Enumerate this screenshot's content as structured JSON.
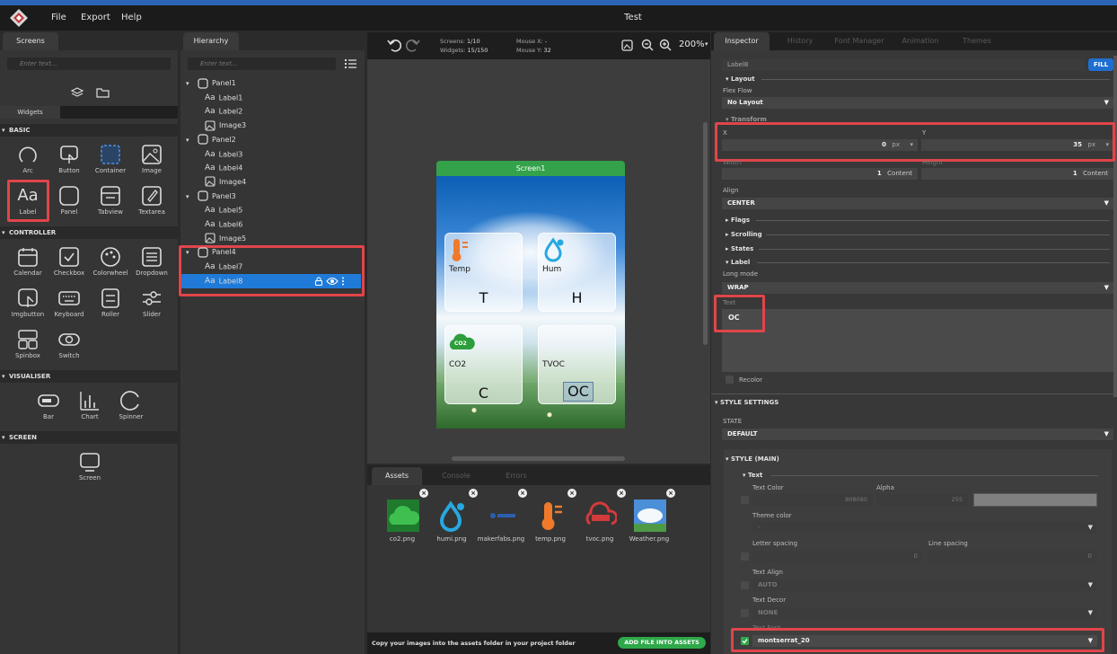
{
  "window": {
    "title": "Test"
  },
  "menu": {
    "file": "File",
    "export": "Export",
    "help": "Help"
  },
  "screens_panel": {
    "tab": "Screens",
    "search_placeholder": "Enter text...",
    "widgets_tab": "Widgets"
  },
  "widgets": {
    "basic": {
      "title": "BASIC",
      "items": [
        "Arc",
        "Button",
        "Container",
        "Image",
        "Label",
        "Panel",
        "Tabview",
        "Textarea"
      ]
    },
    "controller": {
      "title": "CONTROLLER",
      "items": [
        "Calendar",
        "Checkbox",
        "Colorwheel",
        "Dropdown",
        "Imgbutton",
        "Keyboard",
        "Roller",
        "Slider",
        "Spinbox",
        "Switch"
      ]
    },
    "visualiser": {
      "title": "VISUALISER",
      "items": [
        "Bar",
        "Chart",
        "Spinner"
      ]
    },
    "screen": {
      "title": "SCREEN",
      "items": [
        "Screen"
      ]
    }
  },
  "hierarchy": {
    "tab": "Hierarchy",
    "search_placeholder": "Enter text...",
    "rows": [
      {
        "label": "Panel1",
        "type": "panel"
      },
      {
        "label": "Label1",
        "type": "label"
      },
      {
        "label": "Label2",
        "type": "label"
      },
      {
        "label": "Image3",
        "type": "image"
      },
      {
        "label": "Panel2",
        "type": "panel"
      },
      {
        "label": "Label3",
        "type": "label"
      },
      {
        "label": "Label4",
        "type": "label"
      },
      {
        "label": "Image4",
        "type": "image"
      },
      {
        "label": "Panel3",
        "type": "panel"
      },
      {
        "label": "Label5",
        "type": "label"
      },
      {
        "label": "Label6",
        "type": "label"
      },
      {
        "label": "Image5",
        "type": "image"
      },
      {
        "label": "Panel4",
        "type": "panel"
      },
      {
        "label": "Label7",
        "type": "label"
      },
      {
        "label": "Label8",
        "type": "label",
        "selected": true
      }
    ]
  },
  "canvas": {
    "screens_label": "Screens:",
    "screens_value": "1/10",
    "widgets_label": "Widgets:",
    "widgets_value": "15/150",
    "mouse_x_label": "Mouse X:",
    "mouse_x_value": "-",
    "mouse_y_label": "Mouse Y:",
    "mouse_y_value": "32",
    "zoom": "200%",
    "screen_title": "Screen1",
    "cards": [
      {
        "label": "Temp",
        "value": "T"
      },
      {
        "label": "Hum",
        "value": "H"
      },
      {
        "label": "CO2",
        "value": "C",
        "badge": "CO2"
      },
      {
        "label": "TVOC",
        "value": "OC"
      }
    ]
  },
  "bottom": {
    "tabs": [
      "Assets",
      "Console",
      "Errors"
    ],
    "assets": [
      "co2.png",
      "humi.png",
      "makerfabs.png",
      "temp.png",
      "tvoc.png",
      "Weather.png"
    ],
    "hint": "Copy your images into the assets folder in your project folder",
    "add_button": "ADD FILE INTO ASSETS"
  },
  "inspector": {
    "tabs": [
      "Inspector",
      "History",
      "Font Manager",
      "Animation",
      "Themes"
    ],
    "name": "Label8",
    "fill_button": "FILL",
    "layout": {
      "title": "Layout",
      "flex_flow_label": "Flex Flow",
      "flex_flow_value": "No Layout"
    },
    "transform": {
      "title": "Transform",
      "x_label": "X",
      "x_value": "0",
      "x_unit": "px",
      "y_label": "Y",
      "y_value": "35",
      "y_unit": "px",
      "width_label": "Width",
      "width_value": "1",
      "width_unit": "Content",
      "height_label": "Height",
      "height_value": "1",
      "height_unit": "Content"
    },
    "align": {
      "label": "Align",
      "value": "CENTER"
    },
    "collapsed": [
      "Flags",
      "Scrolling",
      "States"
    ],
    "label": {
      "title": "Label",
      "long_mode_label": "Long mode",
      "long_mode_value": "WRAP",
      "text_label": "Text",
      "text_value": "OC",
      "recolor_label": "Recolor"
    },
    "style_settings": {
      "title": "STYLE SETTINGS",
      "state_label": "STATE",
      "state_value": "DEFAULT",
      "style_main": "STYLE (MAIN)",
      "text_section": "Text",
      "text_color_label": "Text Color",
      "text_color_value": "808080",
      "alpha_label": "Alpha",
      "alpha_value": "255",
      "theme_color_label": "Theme color",
      "theme_color_value": "-",
      "letter_spacing_label": "Letter spacing",
      "letter_spacing_value": "0",
      "line_spacing_label": "Line spacing",
      "line_spacing_value": "0",
      "text_align_label": "Text Align",
      "text_align_value": "AUTO",
      "text_decor_label": "Text Decor",
      "text_decor_value": "NONE",
      "text_font_label": "Text Font",
      "text_font_value": "montserrat_20"
    }
  },
  "colors": {
    "accent": "#1f6fd0",
    "highlight": "#e0454a",
    "green": "#2fa84a"
  }
}
